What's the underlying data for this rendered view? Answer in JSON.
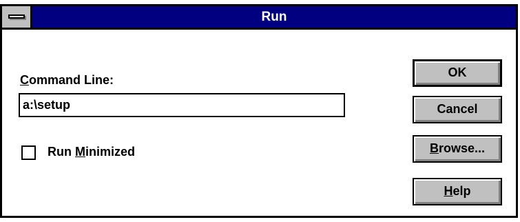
{
  "dialog": {
    "title": "Run",
    "command_line_label_hotkey": "C",
    "command_line_label_rest": "ommand Line:",
    "command_value": "a:\\setup",
    "run_minimized_label_pre": "Run ",
    "run_minimized_label_hotkey": "M",
    "run_minimized_label_rest": "inimized",
    "run_minimized_checked": false
  },
  "buttons": {
    "ok": "OK",
    "cancel": "Cancel",
    "browse_hotkey": "B",
    "browse_rest": "rowse...",
    "help_hotkey": "H",
    "help_rest": "elp"
  },
  "icons": {
    "system_menu": "system-menu-icon"
  }
}
